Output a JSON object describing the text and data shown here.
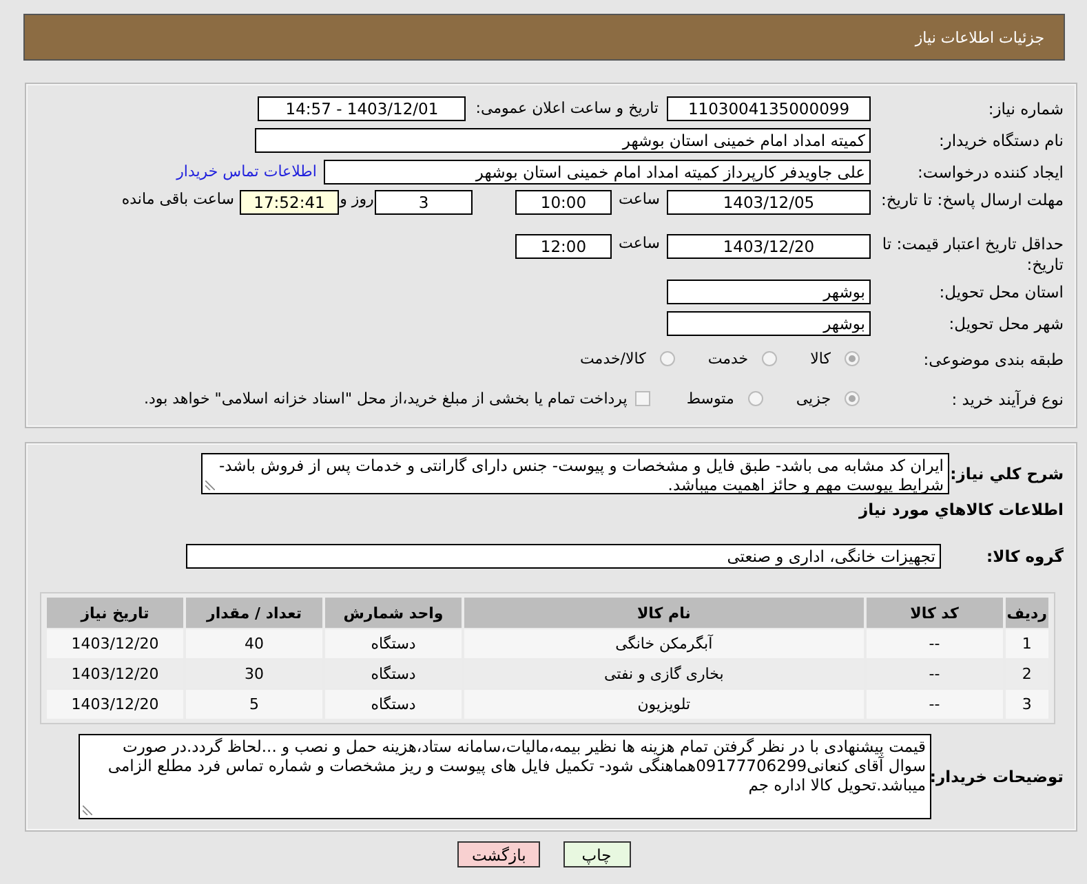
{
  "header": {
    "title": "جزئیات اطلاعات نیاز"
  },
  "need_number": {
    "label": "شماره نیاز:",
    "value": "1103004135000099"
  },
  "announce": {
    "label": "تاریخ و ساعت اعلان عمومی:",
    "value": "1403/12/01 - 14:57"
  },
  "buyer_org": {
    "label": "نام دستگاه خریدار:",
    "value": "کمیته امداد امام خمینی استان بوشهر"
  },
  "requester": {
    "label": "ایجاد کننده درخواست:",
    "value": "علی جاویدفر کارپرداز کمیته امداد امام خمینی استان بوشهر",
    "link": "اطلاعات تماس خریدار"
  },
  "reply_deadline": {
    "label": "مهلت ارسال پاسخ: تا تاریخ:",
    "date": "1403/12/05",
    "time_label": "ساعت",
    "time": "10:00",
    "days": "3",
    "days_label": "روز و",
    "remaining": "17:52:41",
    "remaining_label": "ساعت باقی مانده"
  },
  "price_validity": {
    "label": "حداقل تاریخ اعتبار قیمت: تا تاریخ:",
    "date": "1403/12/20",
    "time_label": "ساعت",
    "time": "12:00"
  },
  "province": {
    "label": "استان محل تحویل:",
    "value": "بوشهر"
  },
  "city": {
    "label": "شهر محل تحویل:",
    "value": "بوشهر"
  },
  "category": {
    "label": "طبقه بندی موضوعی:",
    "options": [
      {
        "label": "کالا",
        "selected": true
      },
      {
        "label": "خدمت",
        "selected": false
      },
      {
        "label": "کالا/خدمت",
        "selected": false
      }
    ]
  },
  "purchase_process": {
    "label": "نوع فرآیند خرید :",
    "options": [
      {
        "label": "جزیی",
        "selected": true
      },
      {
        "label": "متوسط",
        "selected": false
      }
    ],
    "payment": {
      "checked": false,
      "text": "پرداخت تمام یا بخشی از مبلغ خرید،از محل \"اسناد خزانه اسلامی\" خواهد بود."
    }
  },
  "description": {
    "label": "شرح كلي نياز:",
    "value": "ایران کد مشابه می باشد- طبق فایل و مشخصات و پیوست- جنس دارای گارانتی و خدمات پس از فروش باشد- شرایط پیوست مهم و حائز اهمیت میباشد."
  },
  "goods_title": "اطلاعات كالاهاي مورد نياز",
  "goods_group": {
    "label": "گروه كالا:",
    "value": "تجهیزات خانگی، اداری و صنعتی"
  },
  "table": {
    "columns": [
      "ردیف",
      "کد کالا",
      "نام کالا",
      "واحد شمارش",
      "تعداد / مقدار",
      "تاریخ نیاز"
    ],
    "rows": [
      [
        "1",
        "--",
        "آبگرمکن خانگی",
        "دستگاه",
        "40",
        "1403/12/20"
      ],
      [
        "2",
        "--",
        "بخاری گازی و نفتی",
        "دستگاه",
        "30",
        "1403/12/20"
      ],
      [
        "3",
        "--",
        "تلویزیون",
        "دستگاه",
        "5",
        "1403/12/20"
      ]
    ]
  },
  "buyer_notes": {
    "label": "توضیحات خریدار:",
    "value": "قیمت پیشنهادی با در نظر گرفتن تمام هزینه ها نظیر بیمه،مالیات،سامانه ستاد،هزینه حمل و نصب و ...لحاظ گردد.در صورت سوال آقای کنعانی09177706299هماهنگی شود- تکمیل فایل های پیوست و ریز مشخصات و شماره تماس فرد مطلع الزامی میباشد.تحویل کالا اداره جم"
  },
  "buttons": [
    {
      "label": "چاپ",
      "kind": "print"
    },
    {
      "label": "بازگشت",
      "kind": "back"
    }
  ]
}
